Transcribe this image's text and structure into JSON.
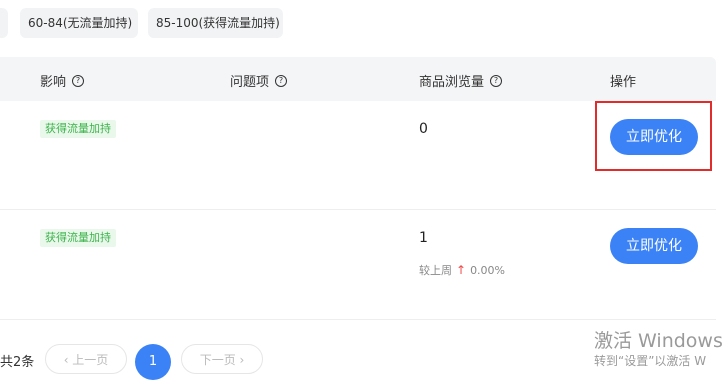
{
  "filters": [
    {
      "label": ""
    },
    {
      "label": "60-84(无流量加持)"
    },
    {
      "label": "85-100(获得流量加持)"
    }
  ],
  "table": {
    "headers": {
      "impact": "影响",
      "issues": "问题项",
      "views": "商品浏览量",
      "actions": "操作"
    },
    "help_glyph": "?",
    "rows": [
      {
        "tag": "获得流量加持",
        "views": "0",
        "trend": null,
        "button": "立即优化"
      },
      {
        "tag": "获得流量加持",
        "views": "1",
        "trend": {
          "label": "较上周",
          "value": "0.00%",
          "arrow": "↑"
        },
        "button": "立即优化"
      }
    ]
  },
  "pagination": {
    "total": "共2条",
    "prev": "‹ 上一页",
    "current": "1",
    "next": "下一页 ›"
  },
  "watermark": {
    "title": "激活 Windows",
    "subtitle": "转到“设置”以激活 W"
  },
  "colors": {
    "primary": "#3b82f6",
    "tag_text": "#3bb34a",
    "tag_bg": "#eaf8ec",
    "trend_up": "#f04848",
    "highlight_border": "#e22c2c"
  }
}
